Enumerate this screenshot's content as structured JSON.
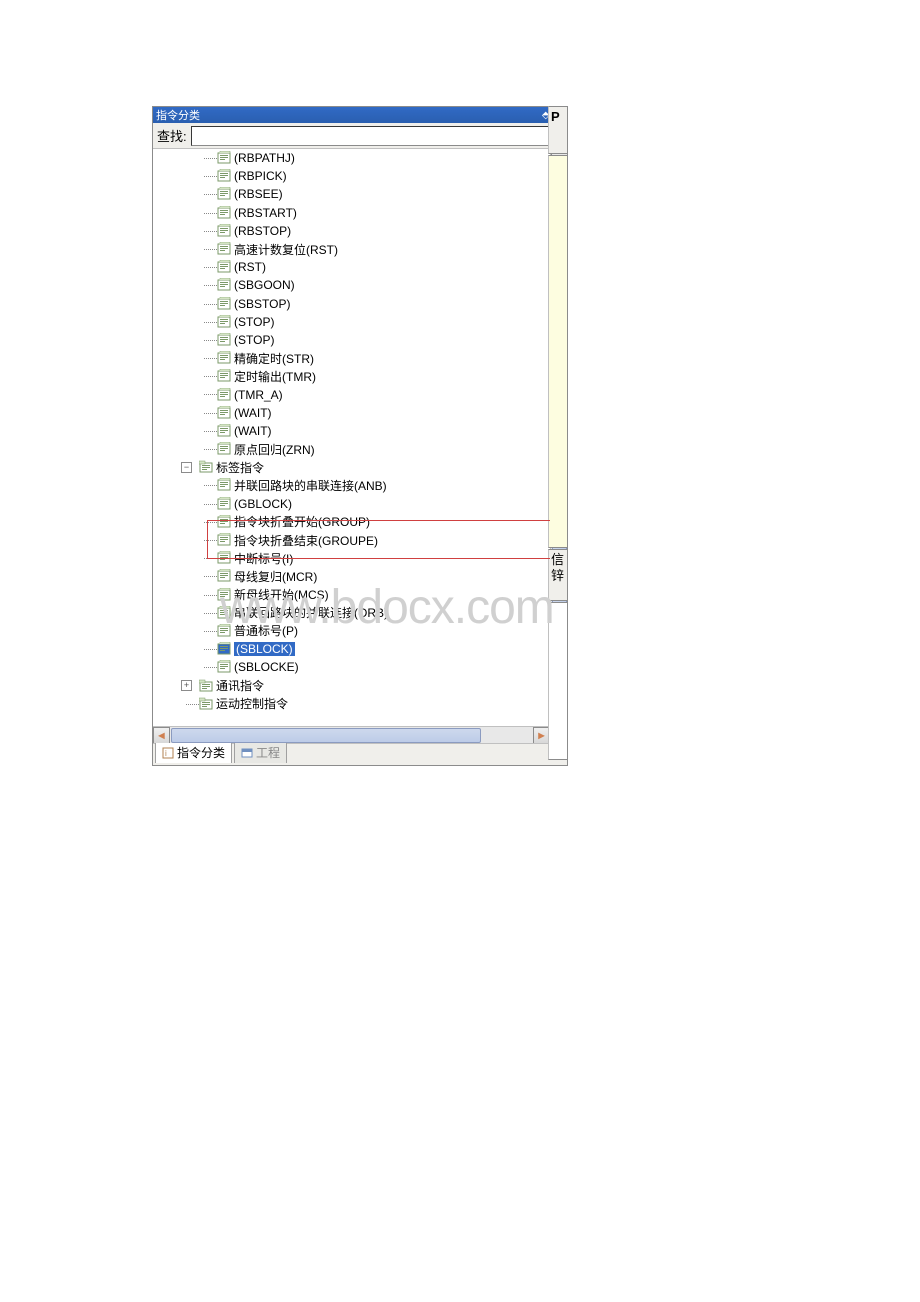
{
  "panel": {
    "title": "指令分类",
    "search_label": "查找:",
    "search_value": ""
  },
  "tree": {
    "items_level2": [
      "(RBPATHJ)",
      "(RBPICK)",
      "(RBSEE)",
      "(RBSTART)",
      "(RBSTOP)",
      "高速计数复位(RST)",
      "(RST)",
      "(SBGOON)",
      "(SBSTOP)",
      "(STOP)",
      "(STOP)",
      "精确定时(STR)",
      "定时输出(TMR)",
      "(TMR_A)",
      "(WAIT)",
      "(WAIT)",
      "原点回归(ZRN)"
    ],
    "label_group": "标签指令",
    "label_children": [
      "并联回路块的串联连接(ANB)",
      "(GBLOCK)",
      "指令块折叠开始(GROUP)",
      "指令块折叠结束(GROUPE)",
      "中断标号(I)",
      "母线复归(MCR)",
      "新母线开始(MCS)",
      "串联回路块的并联连接(ORB)",
      "普通标号(P)",
      "(SBLOCK)",
      "(SBLOCKE)"
    ],
    "comm_group": "通讯指令",
    "motion_group": "运动控制指令"
  },
  "tabs": {
    "tab1": "指令分类",
    "tab2": "工程"
  },
  "right": {
    "top_letter": "P",
    "label1": "信",
    "label2": "锌"
  },
  "watermark": "www.bdocx.com"
}
